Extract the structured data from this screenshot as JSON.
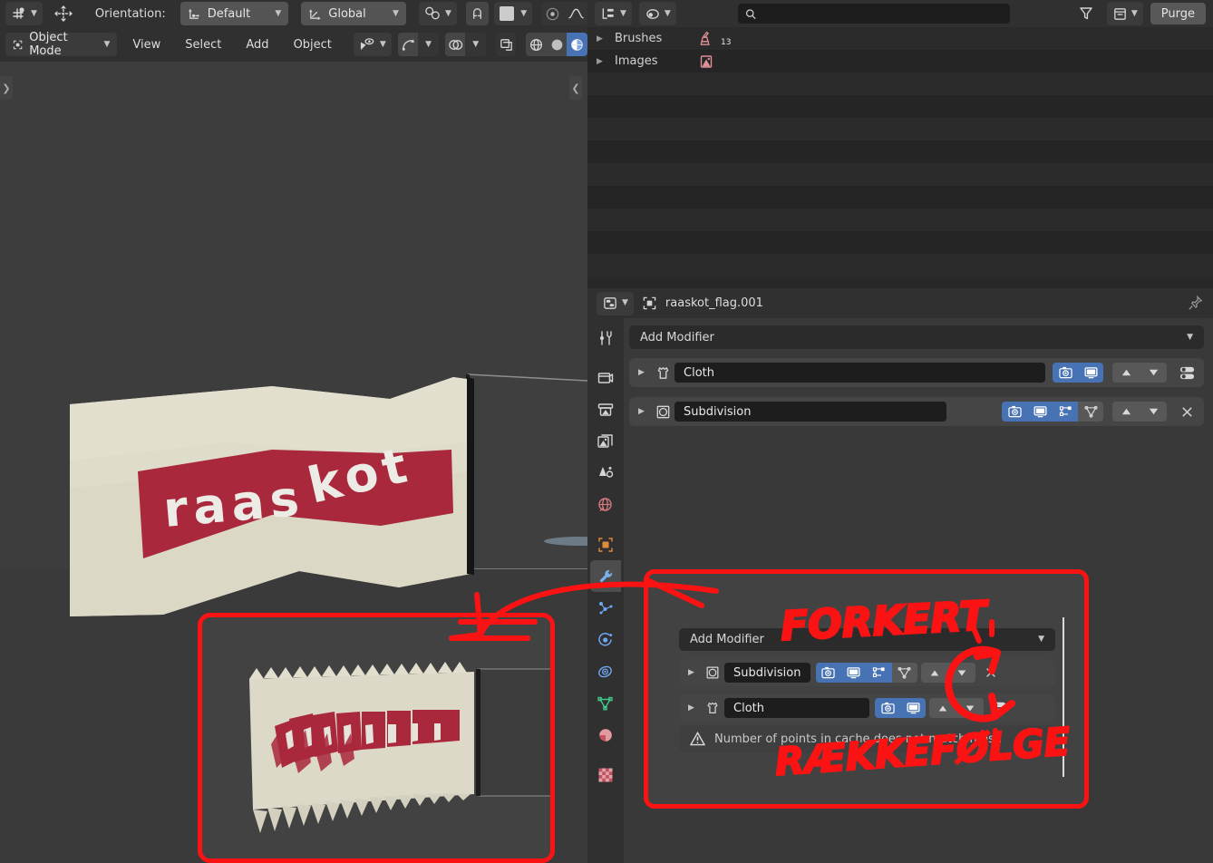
{
  "app": "Blender",
  "topbar": {
    "active_tool": "move-tool",
    "orientation_label": "Orientation:",
    "transform_orientation_value": "Default",
    "transform_pivot_value": "Global",
    "snap_icon": "magnet-icon",
    "snap_dropdown_icon": "snap-increment-icon",
    "proportional_icon": "proportional-editing-icon",
    "falloff_icon": "falloff-smooth-icon"
  },
  "viewport_header": {
    "mode": "Object Mode",
    "menus": [
      "View",
      "Select",
      "Add",
      "Object"
    ],
    "icons": [
      "visibility-icon",
      "gizmo-icon",
      "overlays-icon",
      "xray-toggle-icon",
      "shading-wireframe-icon",
      "shading-solid-icon",
      "shading-material-icon"
    ],
    "active_shading": "shading-material-icon",
    "left_tab_icon": "expand-right-icon",
    "right_tab_icon": "expand-left-icon"
  },
  "viewport": {
    "object_label": "raaskot",
    "flag_text": "raaskot",
    "flag_color": "#e0dccb",
    "flag_band_color": "#a9283c",
    "background_color": "#3d3d3d"
  },
  "outliner": {
    "display_mode_icon": "outliner-display-mode-icon",
    "filter_id_icon": "blender-file-icon",
    "search_placeholder": "",
    "search_value": "",
    "filter_icon": "filter-funnel-icon",
    "filter_settings_icon": "filter-settings-icon",
    "purge_label": "Purge",
    "rows": [
      {
        "label": "Brushes",
        "icon": "brush-icon",
        "count": "13",
        "expanded": false
      },
      {
        "label": "Images",
        "icon": "image-icon",
        "count": "",
        "expanded": false
      }
    ]
  },
  "properties": {
    "editor_type_icon": "properties-editor-icon",
    "object_icon": "object-data-icon",
    "object_name": "raaskot_flag.001",
    "pin_icon": "pin-icon",
    "tabs": [
      {
        "name": "tool",
        "icon": "tool-icon",
        "selected": false,
        "color": "#d4d4d4"
      },
      {
        "name": "render",
        "icon": "render-camera-icon",
        "selected": false,
        "color": "#d4d4d4"
      },
      {
        "name": "output",
        "icon": "printer-icon",
        "selected": false,
        "color": "#d4d4d4"
      },
      {
        "name": "view-layer",
        "icon": "images-icon",
        "selected": false,
        "color": "#d4d4d4"
      },
      {
        "name": "scene",
        "icon": "scene-cone-icon",
        "selected": false,
        "color": "#d4d4d4"
      },
      {
        "name": "world",
        "icon": "world-globe-icon",
        "selected": false,
        "color": "#e07a82"
      },
      {
        "name": "object",
        "icon": "object-square-icon",
        "selected": false,
        "color": "#e08b37"
      },
      {
        "name": "modifiers",
        "icon": "wrench-icon",
        "selected": true,
        "color": "#6da6f0"
      },
      {
        "name": "particles",
        "icon": "particles-icon",
        "selected": false,
        "color": "#6da6f0"
      },
      {
        "name": "physics",
        "icon": "physics-orbit-icon",
        "selected": false,
        "color": "#6da6f0"
      },
      {
        "name": "constraints",
        "icon": "constraints-icon",
        "selected": false,
        "color": "#6da6f0"
      },
      {
        "name": "object-data",
        "icon": "mesh-data-icon",
        "selected": false,
        "color": "#42c98a"
      },
      {
        "name": "material",
        "icon": "material-sphere-icon",
        "selected": false,
        "color": "#e07a82"
      },
      {
        "name": "texture",
        "icon": "texture-checker-icon",
        "selected": false,
        "color": "#e07a82"
      }
    ],
    "add_modifier_label": "Add Modifier",
    "modifiers": [
      {
        "name": "Cloth",
        "icon": "cloth-modifier-icon",
        "expanded": false,
        "toggles": [
          {
            "name": "render-toggle",
            "icon": "camera-icon",
            "on": true
          },
          {
            "name": "realtime-toggle",
            "icon": "display-icon",
            "on": true
          }
        ],
        "has_move_up": true,
        "has_move_down": true,
        "extras_icon": "extras-dropdown-icon",
        "has_close": false
      },
      {
        "name": "Subdivision",
        "icon": "subdivision-modifier-icon",
        "expanded": false,
        "toggles": [
          {
            "name": "render-toggle",
            "icon": "camera-icon",
            "on": true
          },
          {
            "name": "realtime-toggle",
            "icon": "display-icon",
            "on": true
          },
          {
            "name": "editmode-toggle",
            "icon": "edit-mode-icon",
            "on": true
          },
          {
            "name": "oncage-toggle",
            "icon": "on-cage-icon",
            "on": false
          }
        ],
        "has_move_up": true,
        "has_move_down": true,
        "extras_icon": "",
        "has_close": true
      }
    ]
  },
  "callout": {
    "title_annotation": "FORKERT",
    "bottom_annotation": "RÆKKEFØLGE",
    "annotation_color": "#fb1313",
    "add_modifier_label": "Add Modifier",
    "modifiers": [
      {
        "name": "Subdivision",
        "icon": "subdivision-modifier-icon",
        "toggles": [
          {
            "name": "render-toggle",
            "icon": "camera-icon",
            "on": true
          },
          {
            "name": "realtime-toggle",
            "icon": "display-icon",
            "on": true
          },
          {
            "name": "editmode-toggle",
            "icon": "edit-mode-icon",
            "on": true
          },
          {
            "name": "oncage-toggle",
            "icon": "on-cage-icon",
            "on": false
          }
        ],
        "has_close": true,
        "extras_icon": ""
      },
      {
        "name": "Cloth",
        "icon": "cloth-modifier-icon",
        "toggles": [
          {
            "name": "render-toggle",
            "icon": "camera-icon",
            "on": true
          },
          {
            "name": "realtime-toggle",
            "icon": "display-icon",
            "on": true
          }
        ],
        "has_close": false,
        "extras_icon": "extras-dropdown-icon"
      }
    ],
    "warning_icon": "warning-triangle-icon",
    "warning_text": "Number of points in cache does not match mesh"
  },
  "inset": {
    "description": "zoomed-out viewport showing jagged spiked flag mesh",
    "flag_color": "#e0dccb",
    "flag_band_color": "#a9283c",
    "border_color": "#fb1313"
  },
  "colors": {
    "accent_blue": "#4772b3",
    "annotation_red": "#fb1313",
    "panel_bg": "#303030",
    "editor_bg": "#393939",
    "outliner_bg": "#282828",
    "viewport_bg": "#3d3d3d",
    "field_bg": "#1d1d1d"
  }
}
